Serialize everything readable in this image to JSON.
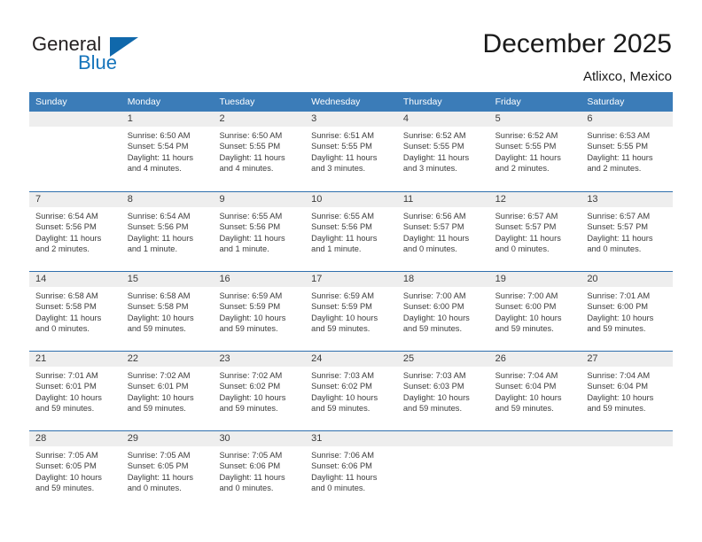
{
  "brand": {
    "name_top": "General",
    "name_bottom": "Blue",
    "accent_color": "#1574bb",
    "triangle_color": "#1068ab"
  },
  "header": {
    "title": "December 2025",
    "location": "Atlixco, Mexico"
  },
  "calendar": {
    "header_color": "#3b7cb8",
    "row_divider_color": "#2f6fad",
    "date_band_color": "#eeeeee",
    "weekdays": [
      "Sunday",
      "Monday",
      "Tuesday",
      "Wednesday",
      "Thursday",
      "Friday",
      "Saturday"
    ],
    "weeks": [
      [
        {
          "date": "",
          "sunrise": "",
          "sunset": "",
          "daylight": "",
          "daylight2": ""
        },
        {
          "date": "1",
          "sunrise": "Sunrise: 6:50 AM",
          "sunset": "Sunset: 5:54 PM",
          "daylight": "Daylight: 11 hours",
          "daylight2": "and 4 minutes."
        },
        {
          "date": "2",
          "sunrise": "Sunrise: 6:50 AM",
          "sunset": "Sunset: 5:55 PM",
          "daylight": "Daylight: 11 hours",
          "daylight2": "and 4 minutes."
        },
        {
          "date": "3",
          "sunrise": "Sunrise: 6:51 AM",
          "sunset": "Sunset: 5:55 PM",
          "daylight": "Daylight: 11 hours",
          "daylight2": "and 3 minutes."
        },
        {
          "date": "4",
          "sunrise": "Sunrise: 6:52 AM",
          "sunset": "Sunset: 5:55 PM",
          "daylight": "Daylight: 11 hours",
          "daylight2": "and 3 minutes."
        },
        {
          "date": "5",
          "sunrise": "Sunrise: 6:52 AM",
          "sunset": "Sunset: 5:55 PM",
          "daylight": "Daylight: 11 hours",
          "daylight2": "and 2 minutes."
        },
        {
          "date": "6",
          "sunrise": "Sunrise: 6:53 AM",
          "sunset": "Sunset: 5:55 PM",
          "daylight": "Daylight: 11 hours",
          "daylight2": "and 2 minutes."
        }
      ],
      [
        {
          "date": "7",
          "sunrise": "Sunrise: 6:54 AM",
          "sunset": "Sunset: 5:56 PM",
          "daylight": "Daylight: 11 hours",
          "daylight2": "and 2 minutes."
        },
        {
          "date": "8",
          "sunrise": "Sunrise: 6:54 AM",
          "sunset": "Sunset: 5:56 PM",
          "daylight": "Daylight: 11 hours",
          "daylight2": "and 1 minute."
        },
        {
          "date": "9",
          "sunrise": "Sunrise: 6:55 AM",
          "sunset": "Sunset: 5:56 PM",
          "daylight": "Daylight: 11 hours",
          "daylight2": "and 1 minute."
        },
        {
          "date": "10",
          "sunrise": "Sunrise: 6:55 AM",
          "sunset": "Sunset: 5:56 PM",
          "daylight": "Daylight: 11 hours",
          "daylight2": "and 1 minute."
        },
        {
          "date": "11",
          "sunrise": "Sunrise: 6:56 AM",
          "sunset": "Sunset: 5:57 PM",
          "daylight": "Daylight: 11 hours",
          "daylight2": "and 0 minutes."
        },
        {
          "date": "12",
          "sunrise": "Sunrise: 6:57 AM",
          "sunset": "Sunset: 5:57 PM",
          "daylight": "Daylight: 11 hours",
          "daylight2": "and 0 minutes."
        },
        {
          "date": "13",
          "sunrise": "Sunrise: 6:57 AM",
          "sunset": "Sunset: 5:57 PM",
          "daylight": "Daylight: 11 hours",
          "daylight2": "and 0 minutes."
        }
      ],
      [
        {
          "date": "14",
          "sunrise": "Sunrise: 6:58 AM",
          "sunset": "Sunset: 5:58 PM",
          "daylight": "Daylight: 11 hours",
          "daylight2": "and 0 minutes."
        },
        {
          "date": "15",
          "sunrise": "Sunrise: 6:58 AM",
          "sunset": "Sunset: 5:58 PM",
          "daylight": "Daylight: 10 hours",
          "daylight2": "and 59 minutes."
        },
        {
          "date": "16",
          "sunrise": "Sunrise: 6:59 AM",
          "sunset": "Sunset: 5:59 PM",
          "daylight": "Daylight: 10 hours",
          "daylight2": "and 59 minutes."
        },
        {
          "date": "17",
          "sunrise": "Sunrise: 6:59 AM",
          "sunset": "Sunset: 5:59 PM",
          "daylight": "Daylight: 10 hours",
          "daylight2": "and 59 minutes."
        },
        {
          "date": "18",
          "sunrise": "Sunrise: 7:00 AM",
          "sunset": "Sunset: 6:00 PM",
          "daylight": "Daylight: 10 hours",
          "daylight2": "and 59 minutes."
        },
        {
          "date": "19",
          "sunrise": "Sunrise: 7:00 AM",
          "sunset": "Sunset: 6:00 PM",
          "daylight": "Daylight: 10 hours",
          "daylight2": "and 59 minutes."
        },
        {
          "date": "20",
          "sunrise": "Sunrise: 7:01 AM",
          "sunset": "Sunset: 6:00 PM",
          "daylight": "Daylight: 10 hours",
          "daylight2": "and 59 minutes."
        }
      ],
      [
        {
          "date": "21",
          "sunrise": "Sunrise: 7:01 AM",
          "sunset": "Sunset: 6:01 PM",
          "daylight": "Daylight: 10 hours",
          "daylight2": "and 59 minutes."
        },
        {
          "date": "22",
          "sunrise": "Sunrise: 7:02 AM",
          "sunset": "Sunset: 6:01 PM",
          "daylight": "Daylight: 10 hours",
          "daylight2": "and 59 minutes."
        },
        {
          "date": "23",
          "sunrise": "Sunrise: 7:02 AM",
          "sunset": "Sunset: 6:02 PM",
          "daylight": "Daylight: 10 hours",
          "daylight2": "and 59 minutes."
        },
        {
          "date": "24",
          "sunrise": "Sunrise: 7:03 AM",
          "sunset": "Sunset: 6:02 PM",
          "daylight": "Daylight: 10 hours",
          "daylight2": "and 59 minutes."
        },
        {
          "date": "25",
          "sunrise": "Sunrise: 7:03 AM",
          "sunset": "Sunset: 6:03 PM",
          "daylight": "Daylight: 10 hours",
          "daylight2": "and 59 minutes."
        },
        {
          "date": "26",
          "sunrise": "Sunrise: 7:04 AM",
          "sunset": "Sunset: 6:04 PM",
          "daylight": "Daylight: 10 hours",
          "daylight2": "and 59 minutes."
        },
        {
          "date": "27",
          "sunrise": "Sunrise: 7:04 AM",
          "sunset": "Sunset: 6:04 PM",
          "daylight": "Daylight: 10 hours",
          "daylight2": "and 59 minutes."
        }
      ],
      [
        {
          "date": "28",
          "sunrise": "Sunrise: 7:05 AM",
          "sunset": "Sunset: 6:05 PM",
          "daylight": "Daylight: 10 hours",
          "daylight2": "and 59 minutes."
        },
        {
          "date": "29",
          "sunrise": "Sunrise: 7:05 AM",
          "sunset": "Sunset: 6:05 PM",
          "daylight": "Daylight: 11 hours",
          "daylight2": "and 0 minutes."
        },
        {
          "date": "30",
          "sunrise": "Sunrise: 7:05 AM",
          "sunset": "Sunset: 6:06 PM",
          "daylight": "Daylight: 11 hours",
          "daylight2": "and 0 minutes."
        },
        {
          "date": "31",
          "sunrise": "Sunrise: 7:06 AM",
          "sunset": "Sunset: 6:06 PM",
          "daylight": "Daylight: 11 hours",
          "daylight2": "and 0 minutes."
        },
        {
          "date": "",
          "sunrise": "",
          "sunset": "",
          "daylight": "",
          "daylight2": ""
        },
        {
          "date": "",
          "sunrise": "",
          "sunset": "",
          "daylight": "",
          "daylight2": ""
        },
        {
          "date": "",
          "sunrise": "",
          "sunset": "",
          "daylight": "",
          "daylight2": ""
        }
      ]
    ]
  }
}
